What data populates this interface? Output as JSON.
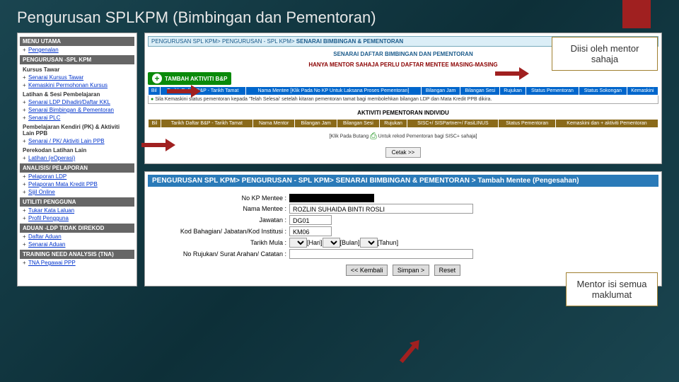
{
  "page_title": "Pengurusan SPLKPM (Bimbingan dan Pementoran)",
  "callout1": "Diisi oleh mentor sahaja",
  "callout2": "Mentor isi semua maklumat",
  "sidebar": {
    "sections": [
      {
        "header": "MENU UTAMA",
        "groups": [
          {
            "sub": "",
            "links": [
              "Pengenalan"
            ]
          }
        ]
      },
      {
        "header": "PENGURUSAN -SPL KPM",
        "groups": [
          {
            "sub": "Kursus Tawar",
            "links": [
              "Senarai Kursus Tawar",
              "Kemaskini Permohonan Kursus"
            ]
          },
          {
            "sub": "Latihan & Sesi Pembelajaran",
            "links": [
              "Senarai LDP Dihadiri/Daftar KKL",
              "Senarai Bimbingan & Pementoran",
              "Senarai PLC"
            ]
          },
          {
            "sub": "Pembelajaran Kendiri (PK) & Aktiviti Lain PPB",
            "links": [
              "Senarai / PK/ Aktiviti Lain PPB"
            ]
          },
          {
            "sub": "Perekodan Latihan Lain",
            "links": [
              "Latihan (eOperasi)"
            ]
          }
        ]
      },
      {
        "header": "ANALISIS/ PELAPORAN",
        "groups": [
          {
            "sub": "",
            "links": [
              "Pelaporan LDP",
              "Pelaporan Mata Kredit PPB",
              "Sijil Online"
            ]
          }
        ]
      },
      {
        "header": "UTILITI PENGGUNA",
        "groups": [
          {
            "sub": "",
            "links": [
              "Tukar Kata Laluan",
              "Profil Pengguna"
            ]
          }
        ]
      },
      {
        "header": "ADUAN -LDP TIDAK DIREKOD",
        "groups": [
          {
            "sub": "",
            "links": [
              "Daftar Aduan",
              "Senarai Aduan"
            ]
          }
        ]
      },
      {
        "header": "TRAINING NEED ANALYSIS (TNA)",
        "groups": [
          {
            "sub": "",
            "links": [
              "TNA Pegawai PPP"
            ]
          }
        ]
      }
    ]
  },
  "panel1": {
    "bc": "PENGURUSAN SPL KPM> PENGURUSAN - SPL KPM> ",
    "bc_cur": "SENARAI BIMBINGAN & PEMENTORAN",
    "title": "SENARAI DAFTAR BIMBINGAN DAN PEMENTORAN",
    "subtitle": "HANYA MENTOR SAHAJA PERLU DAFTAR MENTEE MASING-MASING",
    "add_btn": "TAMBAH AKTIVITI B&P",
    "table1_headers": [
      "Bil",
      "Tarikh Daftar B&P - Tarikh Tamat",
      "Nama Mentee\n[Klik Pada No KP Untuk Laksana Proses Pementoran]",
      "Bilangan Jam",
      "Bilangan Sesi",
      "Rujukan",
      "Status Pementoran",
      "Status Sokongan",
      "Kemaskini"
    ],
    "row_note": "Sila Kemaskini status pementoran kepada 'Telah Selesai' setelah kitaran pementoran tamat bagi membolehkan bilangan LDP dan Mata Kredit PPB dikira.",
    "sec2_title": "AKTIVITI PEMENTORAN INDIVIDU",
    "table2_headers": [
      "Bil",
      "Tarikh Daftar B&P - Tarikh Tamat",
      "Nama Mentor",
      "Bilangan Jam",
      "Bilangan Sesi",
      "Rujukan",
      "SISC+/ SISPartner+/ FasiLINUS",
      "Status Pementoran",
      "Kemaskini dan + aktiviti Pementoran"
    ],
    "klik_note": "[Klik Pada Butang         Untuk rekod Pementoran bagi SISC+ sahaja]",
    "cetak": "Cetak >>"
  },
  "panel2": {
    "bc": "PENGURUSAN SPL KPM> PENGURUSAN - SPL KPM> SENARAI BIMBINGAN & PEMENTORAN > ",
    "bc_cur": "Tambah Mentee (Pengesahan)",
    "fields": {
      "nokp_lbl": "No KP Mentee :",
      "nama_lbl": "Nama Mentee :",
      "nama_val": "ROZLIN SUHAIDA BINTI ROSLI",
      "jaw_lbl": "Jawatan :",
      "jaw_val": "DG01",
      "kod_lbl": "Kod Bahagian/ Jabatan/Kod Institusi :",
      "kod_val": "KM06",
      "tarikh_lbl": "Tarikh Mula :",
      "hari": "[Hari]",
      "bulan": "[Bulan]",
      "tahun": "[Tahun]",
      "ruj_lbl": "No Rujukan/ Surat Arahan/ Catatan :"
    },
    "btns": {
      "kembali": "<< Kembali",
      "simpan": "Simpan >",
      "reset": "Reset"
    }
  }
}
